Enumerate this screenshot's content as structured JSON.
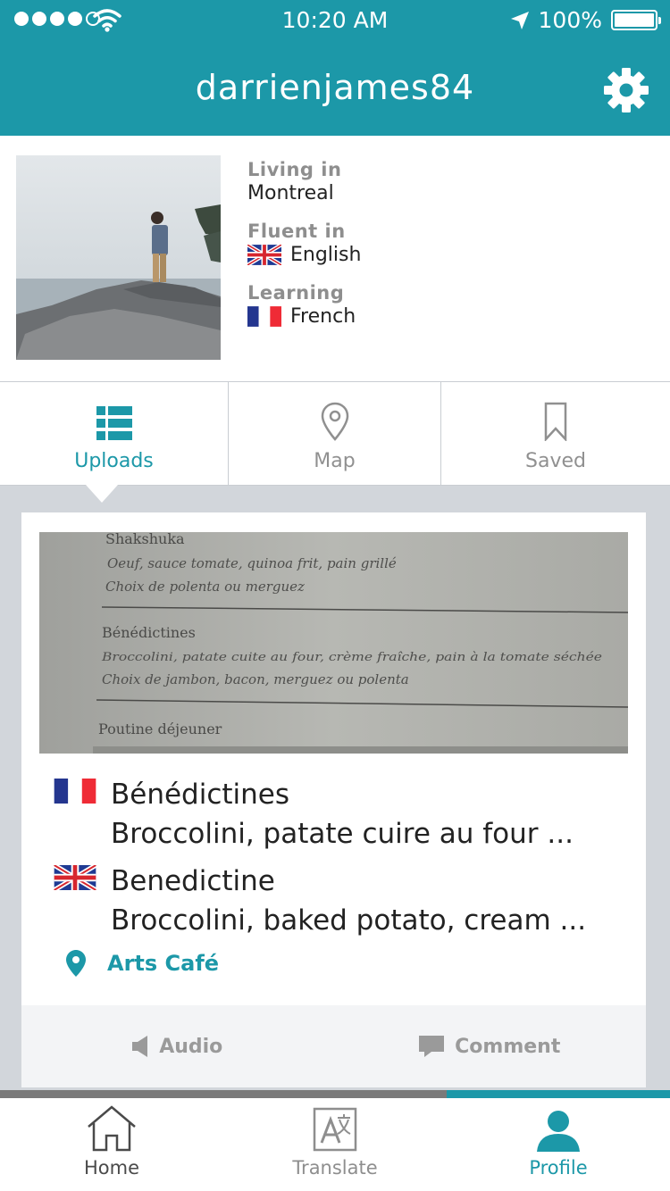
{
  "colors": {
    "accent": "#1c98a8",
    "muted": "#909090",
    "background": "#d2d6db"
  },
  "status_bar": {
    "time": "10:20 AM",
    "battery": "100%",
    "signal_bars": 4,
    "battery_level": 1.0
  },
  "header": {
    "title": "darrienjames84",
    "settings_icon": "gear-icon"
  },
  "profile": {
    "living_label": "Living in",
    "living_value": "Montreal",
    "fluent_label": "Fluent in",
    "fluent_value": "English",
    "learning_label": "Learning",
    "learning_value": "French"
  },
  "tabs": [
    {
      "label": "Uploads",
      "icon": "list-icon",
      "active": true
    },
    {
      "label": "Map",
      "icon": "map-pin-icon",
      "active": false
    },
    {
      "label": "Saved",
      "icon": "bookmark-icon",
      "active": false
    }
  ],
  "upload": {
    "menu_lines": [
      "Shakshuka",
      "Oeuf, sauce tomate, quinoa frit, pain grillé",
      "Choix de polenta ou merguez",
      "Bénédictines",
      "Broccolini, patate cuite au four, crème fraîche, pain à la tomate séchée",
      "Choix de jambon, bacon, merguez ou polenta",
      "Poutine déjeuner"
    ],
    "original_title": "Bénédictines",
    "original_text": "Broccolini, patate cuire au four ...",
    "translated_title": "Benedictine",
    "translated_text": "Broccolini, baked potato, cream ...",
    "place": "Arts Café",
    "audio_label": "Audio",
    "comment_label": "Comment"
  },
  "progress": {
    "fraction": 0.333
  },
  "tabbar": [
    {
      "label": "Home",
      "icon": "home-icon"
    },
    {
      "label": "Translate",
      "icon": "translate-icon"
    },
    {
      "label": "Profile",
      "icon": "profile-icon"
    }
  ]
}
